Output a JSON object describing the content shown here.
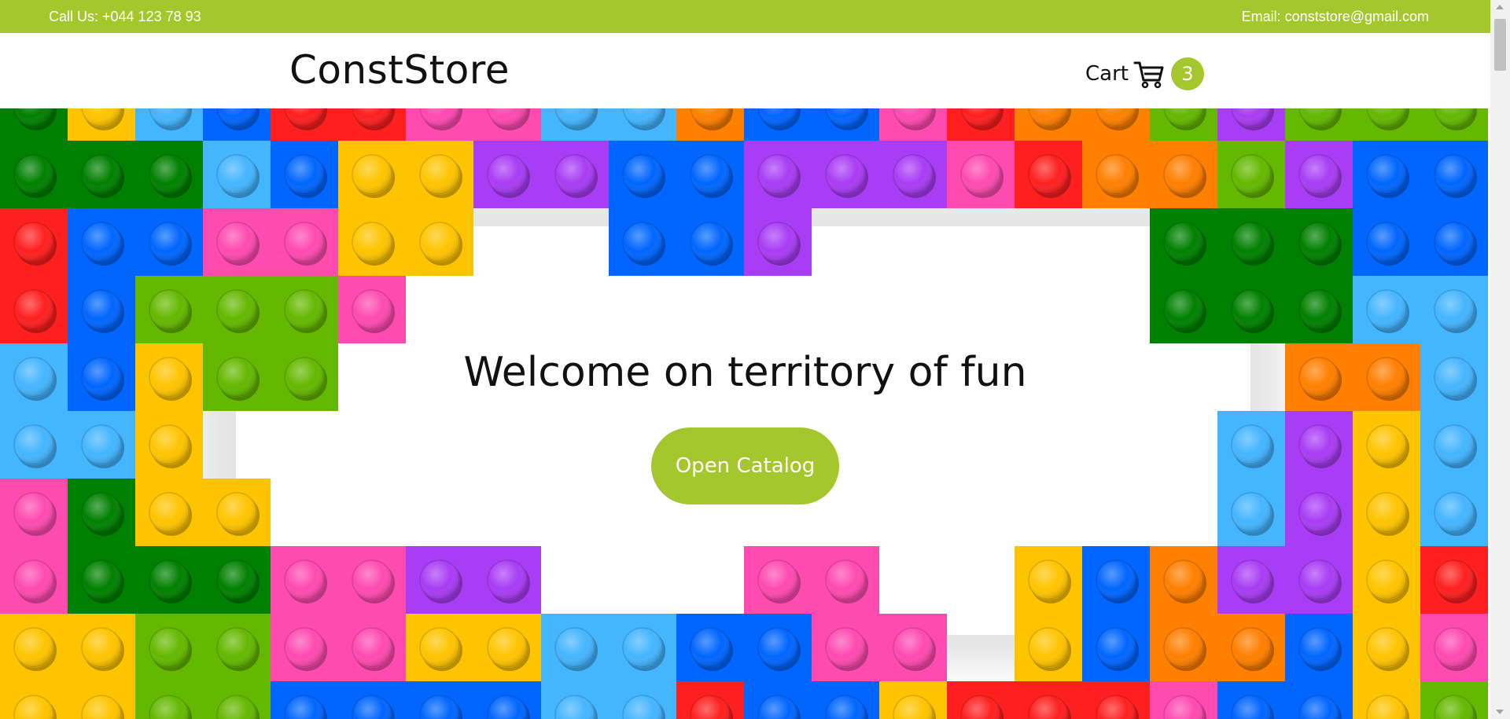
{
  "topbar": {
    "phone": "Call Us: +044 123 78 93",
    "email": "Email: conststore@gmail.com",
    "background": "#a3c72d"
  },
  "header": {
    "logo": "ConstStore",
    "cart_label": "Cart",
    "cart_icon": "cart-icon",
    "cart_count": "3"
  },
  "hero": {
    "title": "Welcome on territory of fun",
    "button_label": "Open Catalog",
    "background_theme": "colorful toy construction bricks",
    "brick_colors": [
      "#ff1f1f",
      "#ffc400",
      "#0066ff",
      "#44b5ff",
      "#008000",
      "#64b800",
      "#ff4ab0",
      "#a93cf5",
      "#ff7f00"
    ]
  },
  "colors": {
    "accent": "#a3c72d"
  }
}
